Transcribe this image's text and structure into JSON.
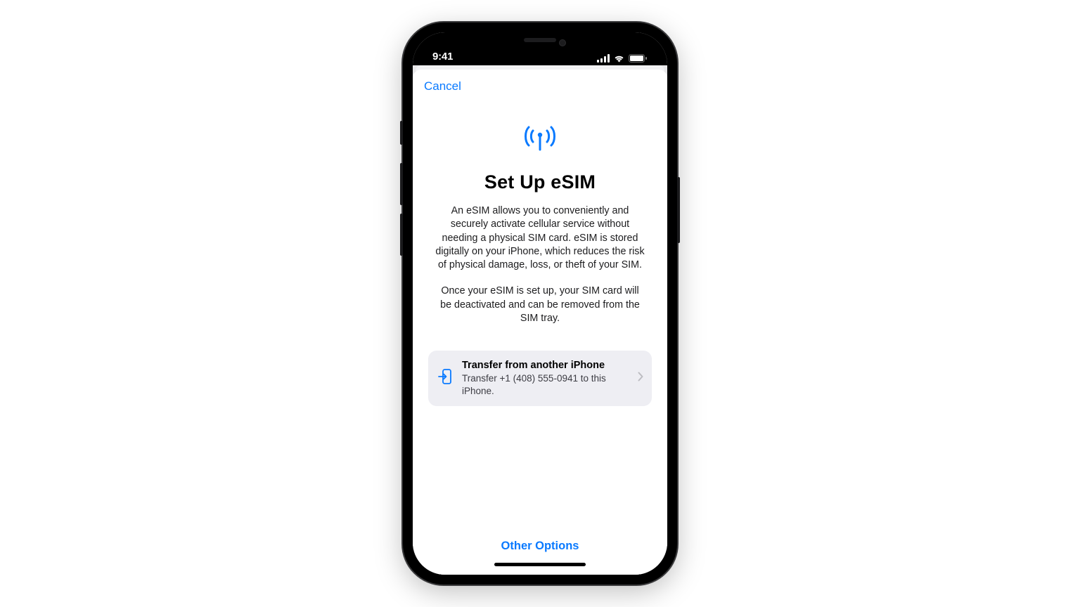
{
  "status": {
    "time": "9:41"
  },
  "nav": {
    "cancel_label": "Cancel"
  },
  "page": {
    "title": "Set Up eSIM",
    "description_1": "An eSIM allows you to conveniently and securely activate cellular service without needing a physical SIM card. eSIM is stored digitally on your iPhone, which reduces the risk of physical damage, loss, or theft of your SIM.",
    "description_2": "Once your eSIM is set up, your SIM card will be deactivated and can be removed from the SIM tray."
  },
  "transfer_card": {
    "title": "Transfer from another iPhone",
    "subtitle": "Transfer +1 (408) 555-0941 to this iPhone."
  },
  "footer": {
    "other_options_label": "Other Options"
  }
}
